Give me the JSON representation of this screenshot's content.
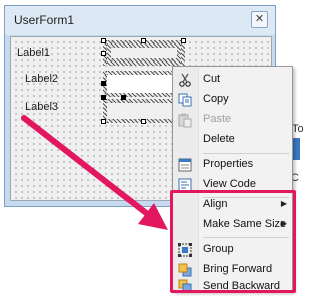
{
  "window": {
    "title": "UserForm1",
    "close_glyph": "✕"
  },
  "form": {
    "labels": [
      "Label1",
      "Label2",
      "Label3"
    ]
  },
  "background_window": {
    "peek_letter_top": "To",
    "peek_letter_bottom": "C"
  },
  "context_menu": {
    "items": [
      {
        "label": "Cut",
        "icon": "scissors-icon",
        "enabled": true
      },
      {
        "label": "Copy",
        "icon": "copy-icon",
        "enabled": true
      },
      {
        "label": "Paste",
        "icon": "paste-icon",
        "enabled": false
      },
      {
        "label": "Delete",
        "icon": "",
        "enabled": true
      },
      {
        "label": "Properties",
        "icon": "properties-icon",
        "enabled": true
      },
      {
        "label": "View Code",
        "icon": "view-code-icon",
        "enabled": true
      },
      {
        "label": "Align",
        "icon": "",
        "enabled": true,
        "submenu": true
      },
      {
        "label": "Make Same Size",
        "icon": "",
        "enabled": true,
        "submenu": true
      },
      {
        "label": "Group",
        "icon": "group-icon",
        "enabled": true
      },
      {
        "label": "Bring Forward",
        "icon": "bring-forward-icon",
        "enabled": true
      },
      {
        "label": "Send Backward",
        "icon": "send-backward-icon",
        "enabled": true
      }
    ],
    "submenu_arrow": "▶"
  },
  "colors": {
    "annotation": "#e2175f",
    "window_frame": "#c6d9ef"
  }
}
